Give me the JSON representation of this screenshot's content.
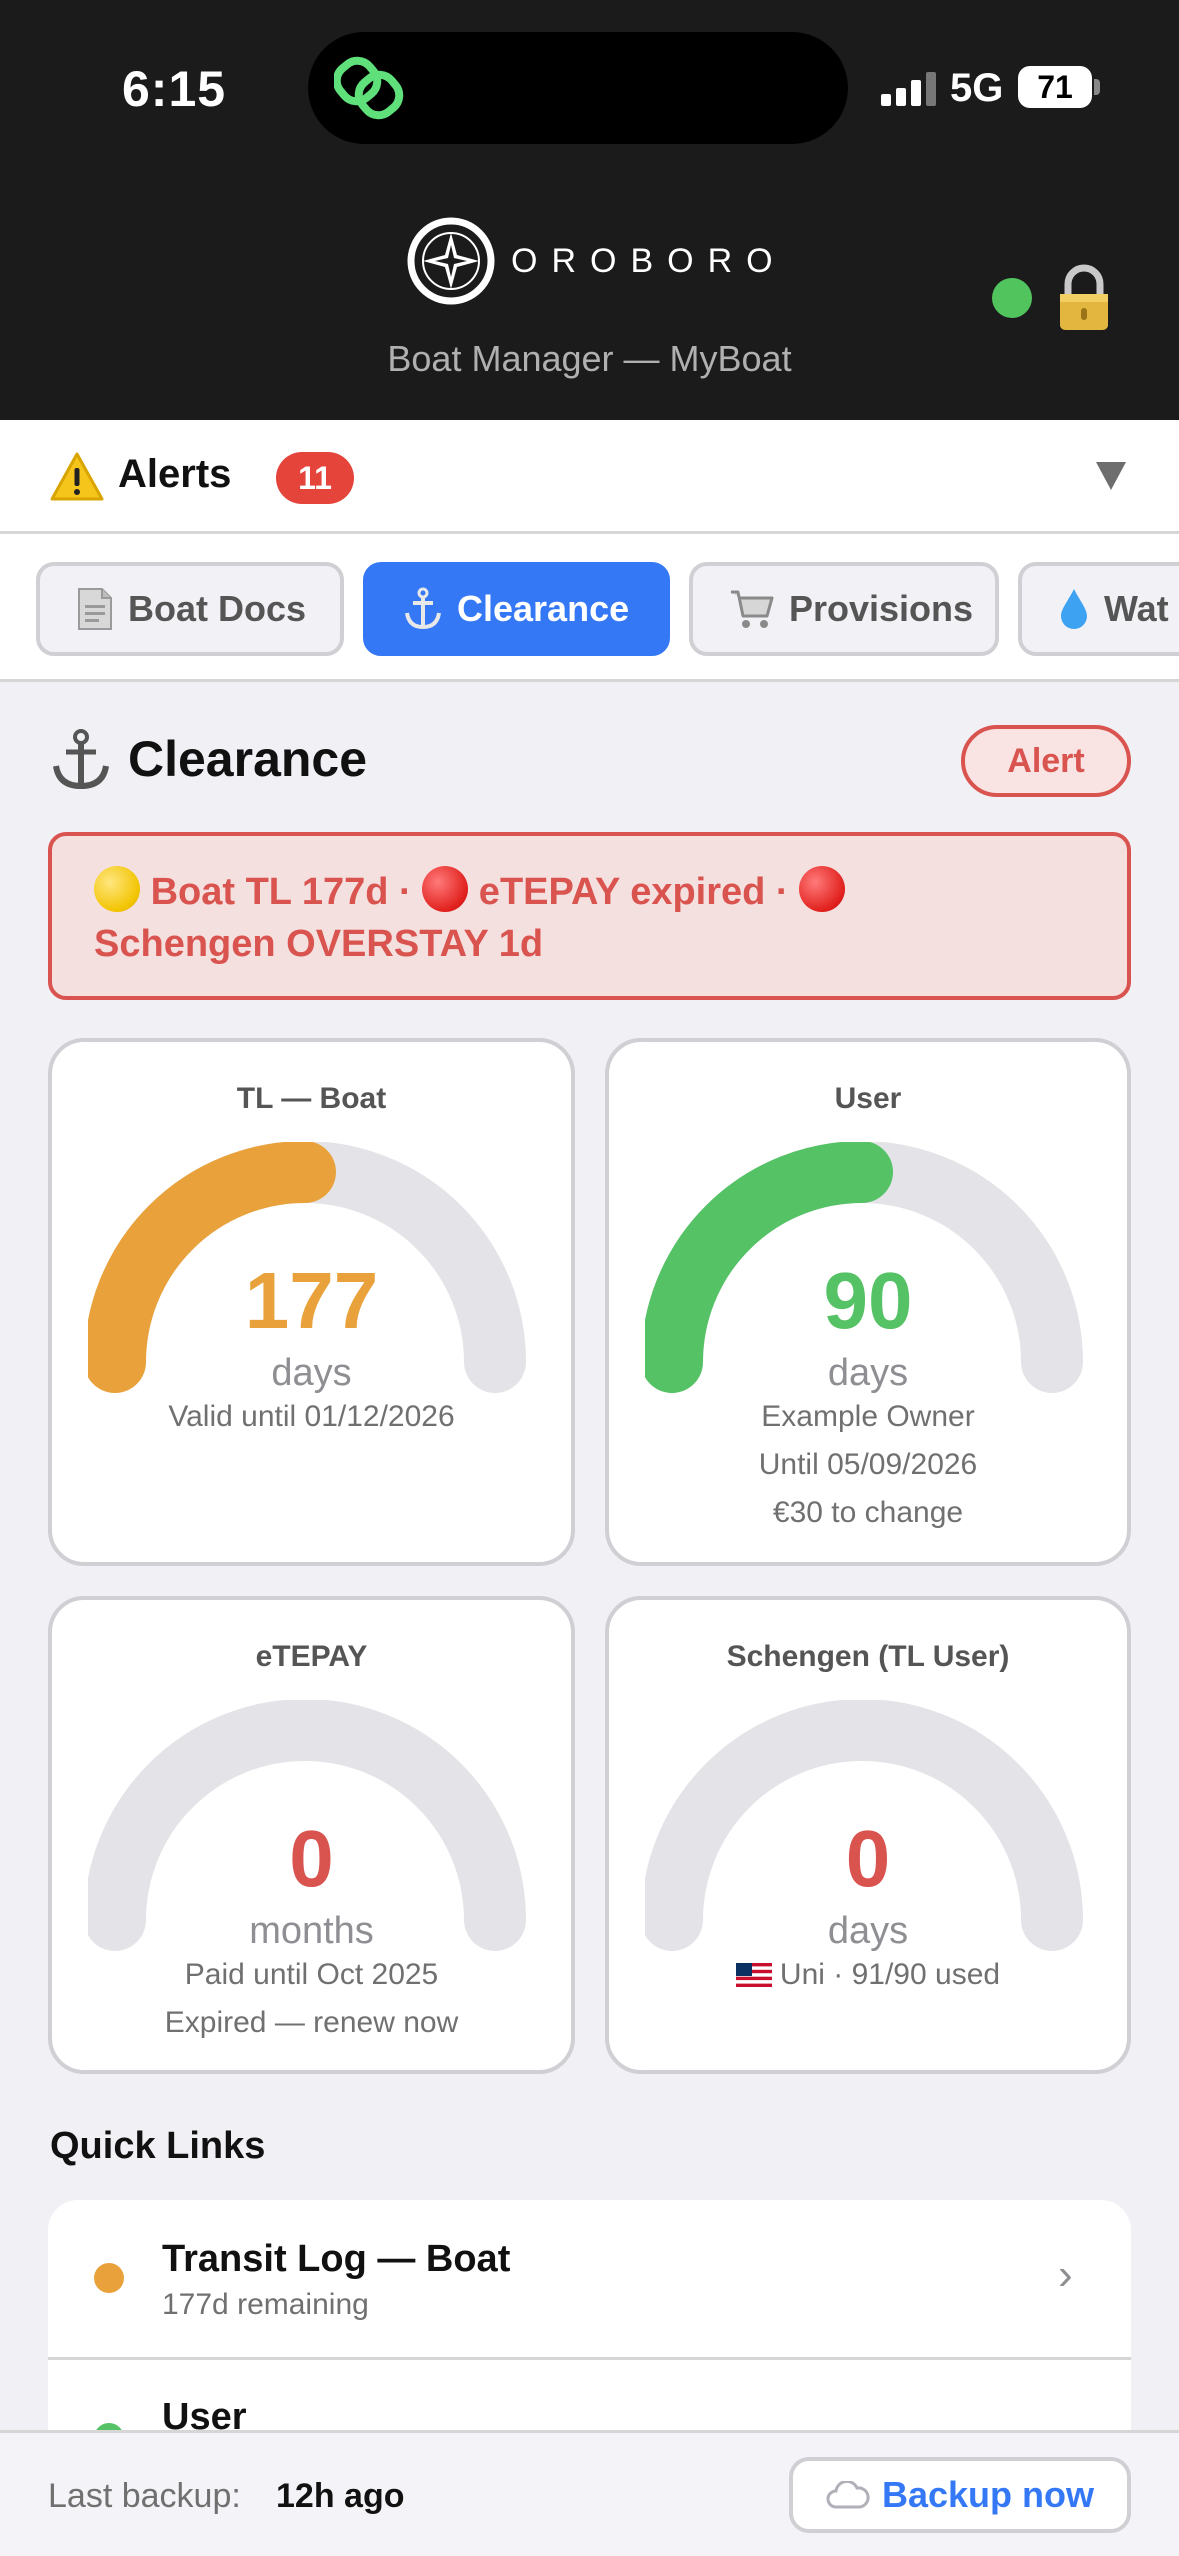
{
  "status_bar": {
    "time": "6:15",
    "network": "5G",
    "battery": "71"
  },
  "header": {
    "brand": "OROBORO",
    "subtitle": "Boat Manager — MyBoat",
    "icons": [
      "compass-logo-icon",
      "online-dot",
      "lock-icon"
    ]
  },
  "alerts": {
    "label": "Alerts",
    "count": "11",
    "icon": "warning-icon"
  },
  "tabs": [
    {
      "label": "Boat Docs",
      "icon": "document-icon",
      "active": false
    },
    {
      "label": "Clearance",
      "icon": "anchor-icon",
      "active": true
    },
    {
      "label": "Provisions",
      "icon": "cart-icon",
      "active": false
    },
    {
      "label": "Wat",
      "icon": "water-drop-icon",
      "active": false
    }
  ],
  "section": {
    "title": "Clearance",
    "badge": "Alert",
    "banner": {
      "part1": "Boat TL 177d · ",
      "part2": " eTEPAY expired · ",
      "part3": "Schengen OVERSTAY 1d"
    }
  },
  "cards": [
    {
      "title": "TL — Boat",
      "value": "177",
      "unit": "days",
      "fill": 0.5,
      "color": "#e9a23b",
      "lines": [
        "Valid until 01/12/2026"
      ]
    },
    {
      "title": "User",
      "value": "90",
      "unit": "days",
      "fill": 0.5,
      "color": "#56c266",
      "lines": [
        "Example Owner",
        "Until 05/09/2026",
        "€30 to change"
      ]
    },
    {
      "title": "eTEPAY",
      "value": "0",
      "unit": "months",
      "fill": 0,
      "color": "#d9534f",
      "lines": [
        "Paid until Oct 2025",
        "Expired — renew now"
      ]
    },
    {
      "title": "Schengen (TL User)",
      "value": "0",
      "unit": "days",
      "fill": 0,
      "color": "#d9534f",
      "lines": [
        "Uni · 91/90 used"
      ]
    }
  ],
  "quick_links": {
    "title": "Quick Links",
    "items": [
      {
        "name": "Transit Log — Boat",
        "sub": "177d remaining",
        "dot": "#e9a23b"
      },
      {
        "name": "User",
        "sub": "",
        "dot": "#56c266"
      }
    ]
  },
  "footer": {
    "label": "Last backup:",
    "value": "12h ago",
    "button": "Backup now"
  }
}
